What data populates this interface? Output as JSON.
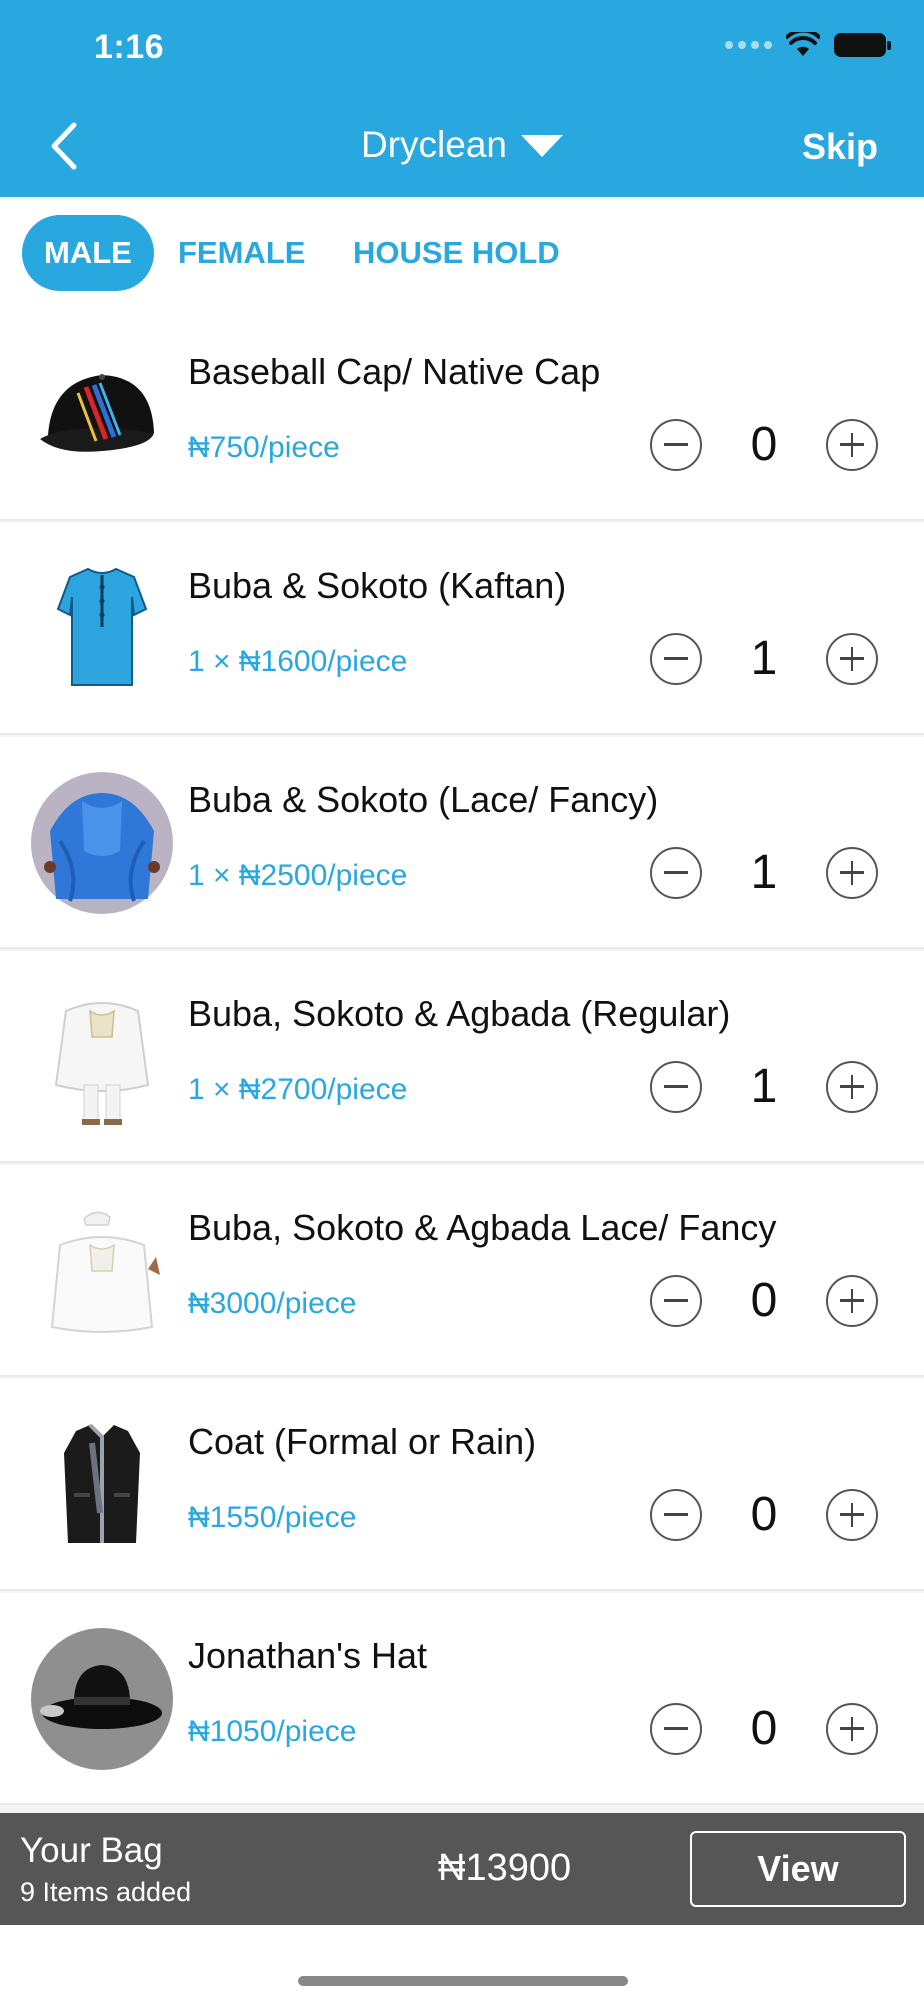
{
  "status_bar": {
    "time": "1:16"
  },
  "header": {
    "title": "Dryclean",
    "skip_label": "Skip"
  },
  "tabs": [
    {
      "label": "MALE",
      "active": true
    },
    {
      "label": "FEMALE",
      "active": false
    },
    {
      "label": "HOUSE HOLD",
      "active": false
    }
  ],
  "items": [
    {
      "name": "Baseball Cap/ Native Cap",
      "price": "₦750/piece",
      "qty": "0",
      "icon": "baseball-cap"
    },
    {
      "name": "Buba & Sokoto (Kaftan)",
      "price": "1 × ₦1600/piece",
      "qty": "1",
      "icon": "kaftan"
    },
    {
      "name": "Buba & Sokoto (Lace/ Fancy)",
      "price": "1 × ₦2500/piece",
      "qty": "1",
      "icon": "lace-agbada"
    },
    {
      "name": "Buba, Sokoto & Agbada (Regular)",
      "price": "1 × ₦2700/piece",
      "qty": "1",
      "icon": "white-agbada"
    },
    {
      "name": "Buba, Sokoto & Agbada Lace/ Fancy",
      "price": "₦3000/piece",
      "qty": "0",
      "icon": "white-agbada-cap"
    },
    {
      "name": "Coat (Formal or Rain)",
      "price": "₦1550/piece",
      "qty": "0",
      "icon": "coat"
    },
    {
      "name": "Jonathan's Hat",
      "price": "₦1050/piece",
      "qty": "0",
      "icon": "fedora-hat"
    }
  ],
  "bag": {
    "title": "Your Bag",
    "subtitle": "9 Items added",
    "total": "₦13900",
    "view_label": "View"
  },
  "colors": {
    "accent": "#29a7df",
    "bag_bar": "#565656"
  }
}
